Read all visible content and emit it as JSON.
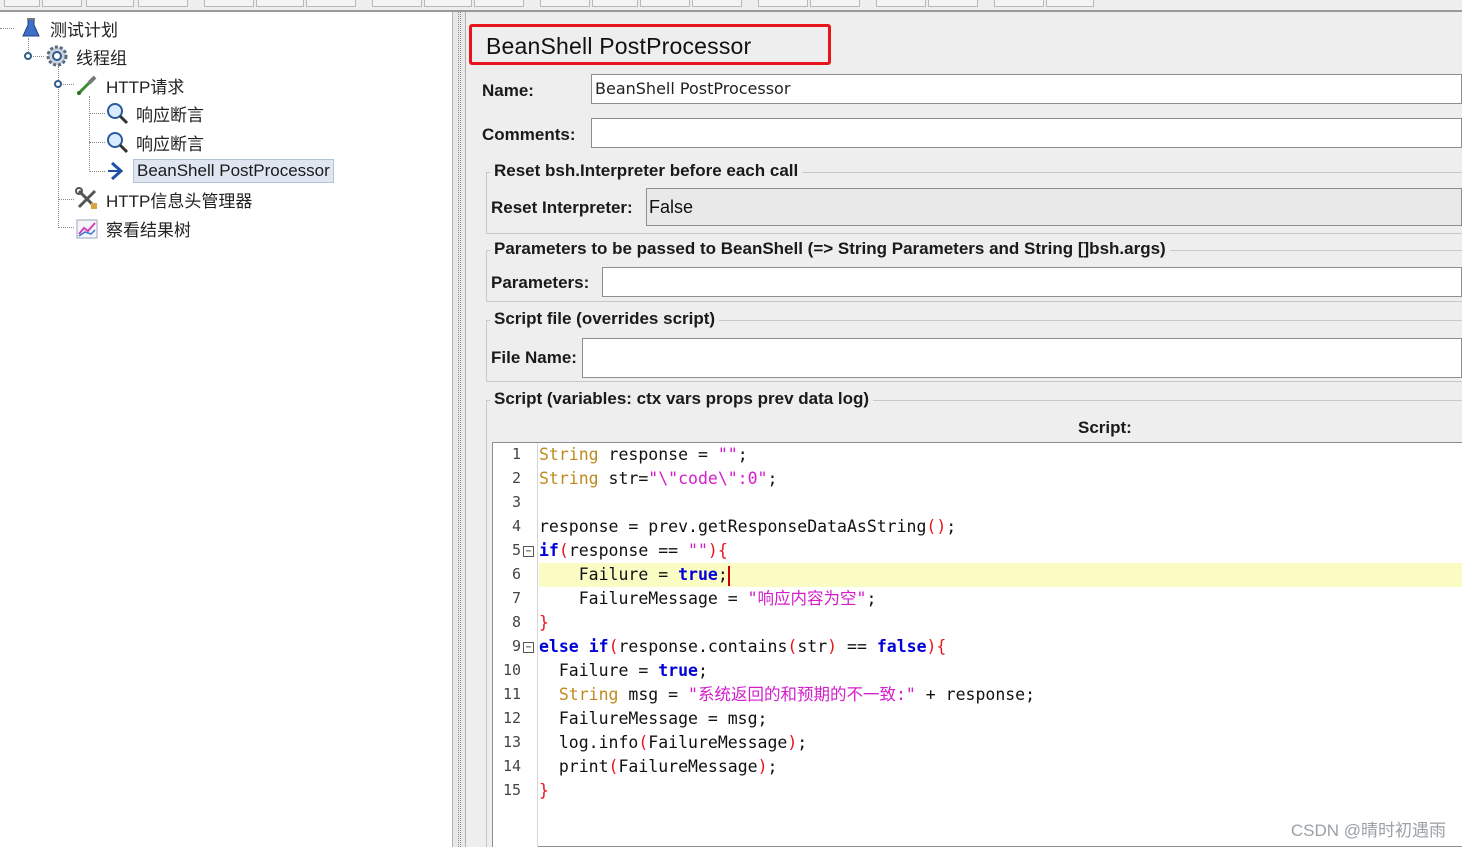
{
  "tree": {
    "items": [
      {
        "label": "测试计划",
        "icon": "flask-icon"
      },
      {
        "label": "线程组",
        "icon": "gear-icon"
      },
      {
        "label": "HTTP请求",
        "icon": "pipette-icon"
      },
      {
        "label": "响应断言",
        "icon": "magnifier-icon"
      },
      {
        "label": "响应断言",
        "icon": "magnifier-icon"
      },
      {
        "label": "BeanShell PostProcessor",
        "icon": "arrow-icon"
      },
      {
        "label": "HTTP信息头管理器",
        "icon": "wrench-icon"
      },
      {
        "label": "察看结果树",
        "icon": "chart-icon"
      }
    ],
    "selected": "BeanShell PostProcessor"
  },
  "panel": {
    "title": "BeanShell PostProcessor",
    "name_label": "Name:",
    "name_value": "BeanShell PostProcessor",
    "comments_label": "Comments:",
    "comments_value": "",
    "reset_group_title": "Reset bsh.Interpreter before each call",
    "reset_label": "Reset Interpreter:",
    "reset_value": "False",
    "params_group_title": "Parameters to be passed to BeanShell (=> String Parameters and String []bsh.args)",
    "params_label": "Parameters:",
    "params_value": "",
    "file_group_title": "Script file (overrides script)",
    "file_label": "File Name:",
    "file_value": "",
    "script_group_title": "Script (variables: ctx vars props prev data log)",
    "script_label": "Script:"
  },
  "editor": {
    "line_numbers": [
      "1",
      "2",
      "3",
      "4",
      "5",
      "6",
      "7",
      "8",
      "9",
      "10",
      "11",
      "12",
      "13",
      "14",
      "15"
    ],
    "highlight_line": 6,
    "lines": [
      [
        {
          "t": "String",
          "c": "ty"
        },
        {
          "t": " response = ",
          "c": "op"
        },
        {
          "t": "\"\"",
          "c": "st"
        },
        {
          "t": ";",
          "c": "op"
        }
      ],
      [
        {
          "t": "String",
          "c": "ty"
        },
        {
          "t": " str=",
          "c": "op"
        },
        {
          "t": "\"\\\"code\\\":0\"",
          "c": "st"
        },
        {
          "t": ";",
          "c": "op"
        }
      ],
      [],
      [
        {
          "t": "response = prev.getResponseDataAsString",
          "c": "op"
        },
        {
          "t": "()",
          "c": "pn"
        },
        {
          "t": ";",
          "c": "op"
        }
      ],
      [
        {
          "t": "if",
          "c": "kw"
        },
        {
          "t": "(",
          "c": "pn"
        },
        {
          "t": "response == ",
          "c": "op"
        },
        {
          "t": "\"\"",
          "c": "st"
        },
        {
          "t": "){",
          "c": "pn"
        }
      ],
      [
        {
          "t": "    Failure = ",
          "c": "op"
        },
        {
          "t": "true",
          "c": "kw"
        },
        {
          "t": ";",
          "c": "op"
        }
      ],
      [
        {
          "t": "    FailureMessage = ",
          "c": "op"
        },
        {
          "t": "\"响应内容为空\"",
          "c": "st"
        },
        {
          "t": ";",
          "c": "op"
        }
      ],
      [
        {
          "t": "}",
          "c": "pn"
        }
      ],
      [
        {
          "t": "else",
          "c": "kw"
        },
        {
          "t": " ",
          "c": "op"
        },
        {
          "t": "if",
          "c": "kw"
        },
        {
          "t": "(",
          "c": "pn"
        },
        {
          "t": "response.contains",
          "c": "op"
        },
        {
          "t": "(",
          "c": "pn"
        },
        {
          "t": "str",
          "c": "op"
        },
        {
          "t": ")",
          "c": "pn"
        },
        {
          "t": " == ",
          "c": "op"
        },
        {
          "t": "false",
          "c": "kw"
        },
        {
          "t": "){",
          "c": "pn"
        }
      ],
      [
        {
          "t": "  Failure = ",
          "c": "op"
        },
        {
          "t": "true",
          "c": "kw"
        },
        {
          "t": ";",
          "c": "op"
        }
      ],
      [
        {
          "t": "  String",
          "c": "ty"
        },
        {
          "t": " msg = ",
          "c": "op"
        },
        {
          "t": "\"系统返回的和预期的不一致:\"",
          "c": "st"
        },
        {
          "t": " + response;",
          "c": "op"
        }
      ],
      [
        {
          "t": "  FailureMessage = msg;",
          "c": "op"
        }
      ],
      [
        {
          "t": "  log.info",
          "c": "op"
        },
        {
          "t": "(",
          "c": "pn"
        },
        {
          "t": "FailureMessage",
          "c": "op"
        },
        {
          "t": ")",
          "c": "pn"
        },
        {
          "t": ";",
          "c": "op"
        }
      ],
      [
        {
          "t": "  print",
          "c": "op"
        },
        {
          "t": "(",
          "c": "pn"
        },
        {
          "t": "FailureMessage",
          "c": "op"
        },
        {
          "t": ")",
          "c": "pn"
        },
        {
          "t": ";",
          "c": "op"
        }
      ],
      [
        {
          "t": "}",
          "c": "pn"
        }
      ]
    ]
  },
  "watermark": "CSDN @晴时初遇雨",
  "colors": {
    "title_box_border": "#e8141b",
    "keyword": "#0000d8",
    "type": "#c08a1e",
    "string": "#d41dcc",
    "paren": "#e8141b",
    "line_highlight": "#fbfbc4"
  }
}
